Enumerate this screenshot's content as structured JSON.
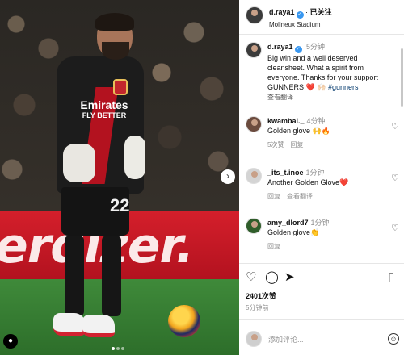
{
  "post": {
    "username": "d.raya1",
    "follow_status": "已关注",
    "location": "Molineux Stadium",
    "caption": "Big win and a well deserved cleansheet. What a spirit from everyone. Thanks for your support GUNNERS",
    "caption_emoji": "❤️ 🙌🏻",
    "hashtag": "#gunners",
    "caption_time": "5分钟",
    "translate": "查看翻译",
    "likes": "2401次赞",
    "posted_ago": "5分钟前",
    "photo": {
      "banner_text": "erdizer.",
      "sponsor": "Emirates",
      "sponsor_sub": "FLY BETTER",
      "shirt_number": "22"
    }
  },
  "comments": [
    {
      "username": "kwambai._",
      "time": "4分钟",
      "text": "Golden glove 🙌🔥",
      "likes": "5次赞",
      "reply": "回复"
    },
    {
      "username": "_its_t.inoe",
      "time": "1分钟",
      "text": "Another Golden Glove❤️",
      "reply": "回复",
      "translate": "查看翻译"
    },
    {
      "username": "amy_dlord7",
      "time": "1分钟",
      "text": "Golden glove👏",
      "reply": "回复"
    }
  ],
  "composer": {
    "placeholder": "添加评论..."
  },
  "icons": {
    "verified": "verified-badge-icon",
    "heart": "heart-icon",
    "comment": "comment-icon",
    "share": "share-icon",
    "bookmark": "bookmark-icon",
    "emoji": "emoji-icon",
    "next": "chevron-right-icon"
  },
  "colors": {
    "verified": "#3897f0",
    "hashtag": "#00376b",
    "muted": "#8e8e8e"
  }
}
